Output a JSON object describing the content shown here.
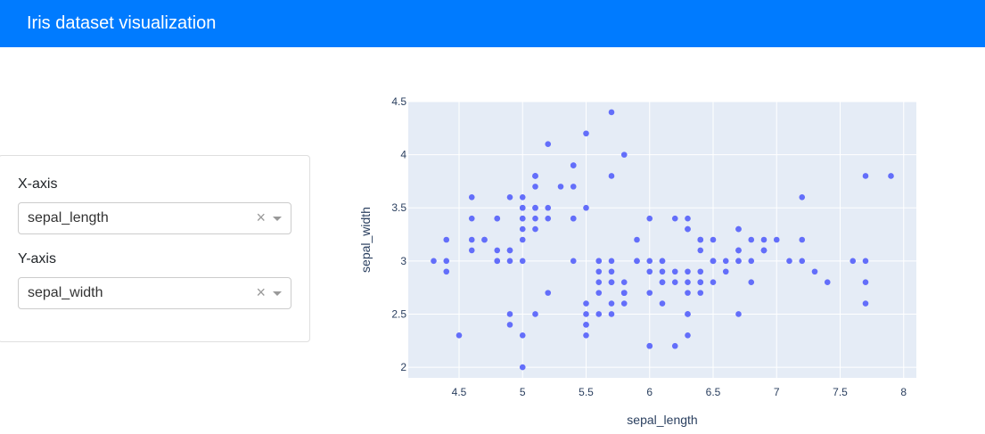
{
  "header": {
    "title": "Iris dataset visualization"
  },
  "controls": {
    "x_label": "X-axis",
    "x_value": "sepal_length",
    "y_label": "Y-axis",
    "y_value": "sepal_width",
    "clear_glyph": "×"
  },
  "colors": {
    "navbar": "#007bff",
    "marker": "#636efa",
    "plot_bg": "#e5ecf6"
  },
  "chart_data": {
    "type": "scatter",
    "xlabel": "sepal_length",
    "ylabel": "sepal_width",
    "xlim": [
      4.1,
      8.1
    ],
    "ylim": [
      1.9,
      4.5
    ],
    "xticks": [
      "4.5",
      "5",
      "5.5",
      "6",
      "6.5",
      "7",
      "7.5",
      "8"
    ],
    "yticks": [
      "2",
      "2.5",
      "3",
      "3.5",
      "4",
      "4.5"
    ],
    "grid": true,
    "points": [
      [
        5.1,
        3.5
      ],
      [
        4.9,
        3.0
      ],
      [
        4.7,
        3.2
      ],
      [
        4.6,
        3.1
      ],
      [
        5.0,
        3.6
      ],
      [
        5.4,
        3.9
      ],
      [
        4.6,
        3.4
      ],
      [
        5.0,
        3.4
      ],
      [
        4.4,
        2.9
      ],
      [
        4.9,
        3.1
      ],
      [
        5.4,
        3.7
      ],
      [
        4.8,
        3.4
      ],
      [
        4.8,
        3.0
      ],
      [
        4.3,
        3.0
      ],
      [
        5.8,
        4.0
      ],
      [
        5.7,
        4.4
      ],
      [
        5.4,
        3.9
      ],
      [
        5.1,
        3.5
      ],
      [
        5.7,
        3.8
      ],
      [
        5.1,
        3.8
      ],
      [
        5.4,
        3.4
      ],
      [
        5.1,
        3.7
      ],
      [
        4.6,
        3.6
      ],
      [
        5.1,
        3.3
      ],
      [
        4.8,
        3.4
      ],
      [
        5.0,
        3.0
      ],
      [
        5.0,
        3.4
      ],
      [
        5.2,
        3.5
      ],
      [
        5.2,
        3.4
      ],
      [
        4.7,
        3.2
      ],
      [
        4.8,
        3.1
      ],
      [
        5.4,
        3.4
      ],
      [
        5.2,
        4.1
      ],
      [
        5.5,
        4.2
      ],
      [
        4.9,
        3.1
      ],
      [
        5.0,
        3.2
      ],
      [
        5.5,
        3.5
      ],
      [
        4.9,
        3.6
      ],
      [
        4.4,
        3.0
      ],
      [
        5.1,
        3.4
      ],
      [
        5.0,
        3.5
      ],
      [
        4.5,
        2.3
      ],
      [
        4.4,
        3.2
      ],
      [
        5.0,
        3.5
      ],
      [
        5.1,
        3.8
      ],
      [
        4.8,
        3.0
      ],
      [
        5.1,
        3.8
      ],
      [
        4.6,
        3.2
      ],
      [
        5.3,
        3.7
      ],
      [
        5.0,
        3.3
      ],
      [
        7.0,
        3.2
      ],
      [
        6.4,
        3.2
      ],
      [
        6.9,
        3.1
      ],
      [
        5.5,
        2.3
      ],
      [
        6.5,
        2.8
      ],
      [
        5.7,
        2.8
      ],
      [
        6.3,
        3.3
      ],
      [
        4.9,
        2.4
      ],
      [
        6.6,
        2.9
      ],
      [
        5.2,
        2.7
      ],
      [
        5.0,
        2.0
      ],
      [
        5.9,
        3.0
      ],
      [
        6.0,
        2.2
      ],
      [
        6.1,
        2.9
      ],
      [
        5.6,
        2.9
      ],
      [
        6.7,
        3.1
      ],
      [
        5.6,
        3.0
      ],
      [
        5.8,
        2.7
      ],
      [
        6.2,
        2.2
      ],
      [
        5.6,
        2.5
      ],
      [
        5.9,
        3.2
      ],
      [
        6.1,
        2.8
      ],
      [
        6.3,
        2.5
      ],
      [
        6.1,
        2.8
      ],
      [
        6.4,
        2.9
      ],
      [
        6.6,
        3.0
      ],
      [
        6.8,
        2.8
      ],
      [
        6.7,
        3.0
      ],
      [
        6.0,
        2.9
      ],
      [
        5.7,
        2.6
      ],
      [
        5.5,
        2.4
      ],
      [
        5.5,
        2.4
      ],
      [
        5.8,
        2.7
      ],
      [
        6.0,
        2.7
      ],
      [
        5.4,
        3.0
      ],
      [
        6.0,
        3.4
      ],
      [
        6.7,
        3.1
      ],
      [
        6.3,
        2.3
      ],
      [
        5.6,
        3.0
      ],
      [
        5.5,
        2.5
      ],
      [
        5.5,
        2.6
      ],
      [
        6.1,
        3.0
      ],
      [
        5.8,
        2.6
      ],
      [
        5.0,
        2.3
      ],
      [
        5.6,
        2.7
      ],
      [
        5.7,
        3.0
      ],
      [
        5.7,
        2.9
      ],
      [
        6.2,
        2.9
      ],
      [
        5.1,
        2.5
      ],
      [
        5.7,
        2.8
      ],
      [
        6.3,
        3.3
      ],
      [
        5.8,
        2.7
      ],
      [
        7.1,
        3.0
      ],
      [
        6.3,
        2.9
      ],
      [
        6.5,
        3.0
      ],
      [
        7.6,
        3.0
      ],
      [
        4.9,
        2.5
      ],
      [
        7.3,
        2.9
      ],
      [
        6.7,
        2.5
      ],
      [
        7.2,
        3.6
      ],
      [
        6.5,
        3.2
      ],
      [
        6.4,
        2.7
      ],
      [
        6.8,
        3.0
      ],
      [
        5.7,
        2.5
      ],
      [
        5.8,
        2.8
      ],
      [
        6.4,
        3.2
      ],
      [
        6.5,
        3.0
      ],
      [
        7.7,
        3.8
      ],
      [
        7.7,
        2.6
      ],
      [
        6.0,
        2.2
      ],
      [
        6.9,
        3.2
      ],
      [
        5.6,
        2.8
      ],
      [
        7.7,
        2.8
      ],
      [
        6.3,
        2.7
      ],
      [
        6.7,
        3.3
      ],
      [
        7.2,
        3.2
      ],
      [
        6.2,
        2.8
      ],
      [
        6.1,
        3.0
      ],
      [
        6.4,
        2.8
      ],
      [
        7.2,
        3.0
      ],
      [
        7.4,
        2.8
      ],
      [
        7.9,
        3.8
      ],
      [
        6.4,
        2.8
      ],
      [
        6.3,
        2.8
      ],
      [
        6.1,
        2.6
      ],
      [
        7.7,
        3.0
      ],
      [
        6.3,
        3.4
      ],
      [
        6.4,
        3.1
      ],
      [
        6.0,
        3.0
      ],
      [
        6.9,
        3.1
      ],
      [
        6.7,
        3.1
      ],
      [
        6.9,
        3.1
      ],
      [
        5.8,
        2.7
      ],
      [
        6.8,
        3.2
      ],
      [
        6.7,
        3.3
      ],
      [
        6.7,
        3.0
      ],
      [
        6.3,
        2.5
      ],
      [
        6.5,
        3.0
      ],
      [
        6.2,
        3.4
      ],
      [
        5.9,
        3.0
      ]
    ]
  }
}
